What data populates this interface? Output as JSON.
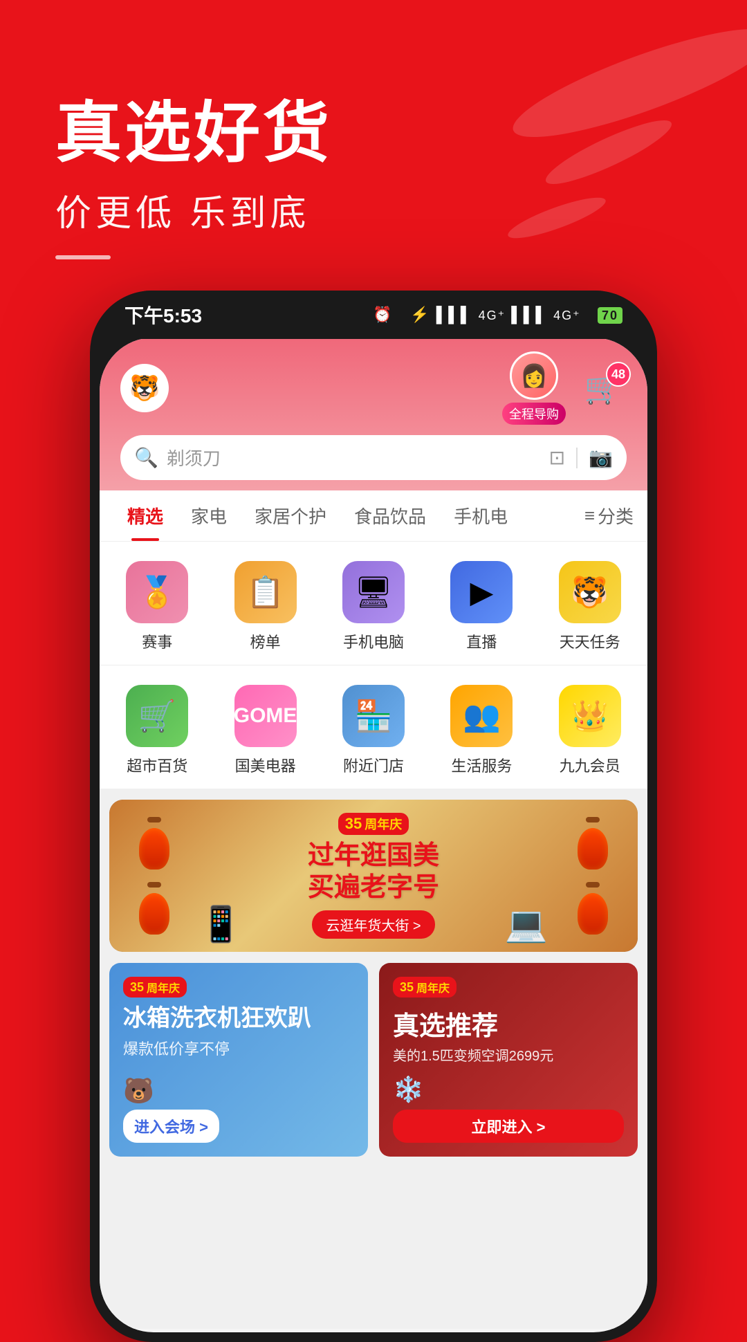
{
  "app": {
    "title": "国美电器",
    "hero_title": "真选好货",
    "hero_subtitle": "价更低 乐到底"
  },
  "status_bar": {
    "time": "下午5:53",
    "signal": "4G+",
    "battery": "70"
  },
  "header": {
    "search_placeholder": "剃须刀",
    "guide_label": "全程导购",
    "cart_badge": "48"
  },
  "nav_tabs": [
    {
      "label": "精选",
      "active": true
    },
    {
      "label": "家电",
      "active": false
    },
    {
      "label": "家居个护",
      "active": false
    },
    {
      "label": "食品饮品",
      "active": false
    },
    {
      "label": "手机电",
      "active": false
    },
    {
      "label": "三分类",
      "active": false
    }
  ],
  "icon_grid_row1": [
    {
      "label": "赛事",
      "icon": "🏆",
      "color": "#e8739a"
    },
    {
      "label": "榜单",
      "icon": "📊",
      "color": "#f0a030"
    },
    {
      "label": "手机电脑",
      "icon": "💻",
      "color": "#9370db"
    },
    {
      "label": "直播",
      "icon": "▶",
      "color": "#4169e1"
    },
    {
      "label": "天天任务",
      "icon": "🐯",
      "color": "#f5c518"
    }
  ],
  "icon_grid_row2": [
    {
      "label": "超市百货",
      "icon": "🛒",
      "color": "#4caf50"
    },
    {
      "label": "国美电器",
      "icon": "G",
      "color": "#ff69b4"
    },
    {
      "label": "附近门店",
      "icon": "🏪",
      "color": "#4169e1"
    },
    {
      "label": "生活服务",
      "icon": "👥",
      "color": "#ffa500"
    },
    {
      "label": "九九会员",
      "icon": "👑",
      "color": "#ffa500"
    }
  ],
  "main_banner": {
    "tag": "35周年庆",
    "title_line1": "过年逛国美",
    "title_line2": "买遍老字号",
    "subtitle": "云逛年货大街",
    "btn_label": "云逛年货大街 >"
  },
  "product_card_left": {
    "tag": "35周年庆",
    "title": "冰箱洗衣机狂欢趴",
    "subtitle": "爆款低价享不停",
    "btn_label": "进入会场 >"
  },
  "product_card_right": {
    "tag": "35周年庆",
    "title": "真选推荐",
    "subtitle": "美的1.5匹变频空调2699元",
    "btn_label": "立即进入 >"
  }
}
